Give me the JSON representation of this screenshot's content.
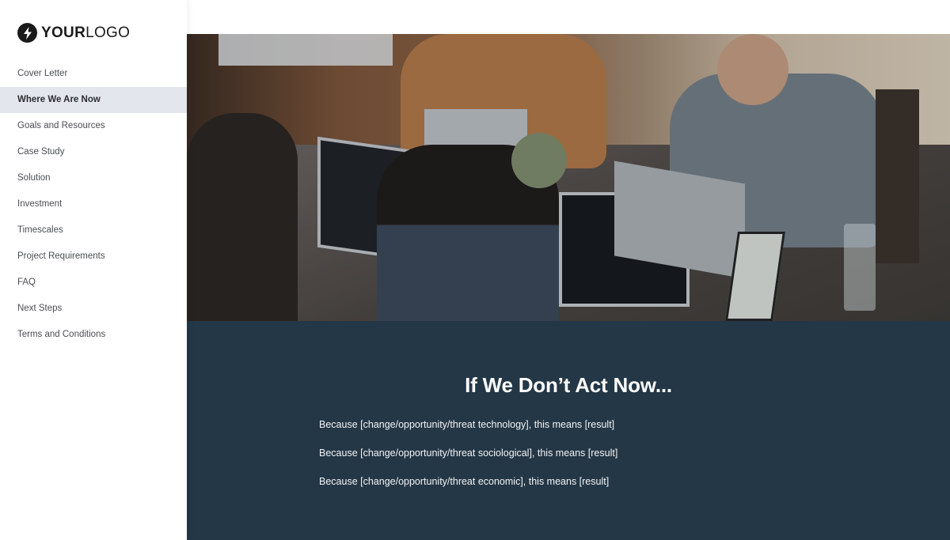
{
  "logo": {
    "icon": "lightning-bolt-icon",
    "text_bold": "YOUR",
    "text_light": "LOGO"
  },
  "nav": {
    "active_index": 1,
    "items": [
      {
        "label": "Cover Letter"
      },
      {
        "label": "Where We Are Now"
      },
      {
        "label": "Goals and Resources"
      },
      {
        "label": "Case Study"
      },
      {
        "label": "Solution"
      },
      {
        "label": "Investment"
      },
      {
        "label": "Timescales"
      },
      {
        "label": "Project Requirements"
      },
      {
        "label": "FAQ"
      },
      {
        "label": "Next Steps"
      },
      {
        "label": "Terms and Conditions"
      }
    ]
  },
  "hero": {
    "image_description": "Team working on laptops around a wooden table"
  },
  "section": {
    "title": "If We Don’t Act Now...",
    "lines": [
      "Because [change/opportunity/threat technology], this means [result]",
      "Because [change/opportunity/threat sociological], this means [result]",
      "Because [change/opportunity/threat economic], this means [result]"
    ]
  },
  "colors": {
    "panel_bg": "#243746",
    "active_nav_bg": "#e3e6ec",
    "logo_dark": "#1a1a1a"
  }
}
